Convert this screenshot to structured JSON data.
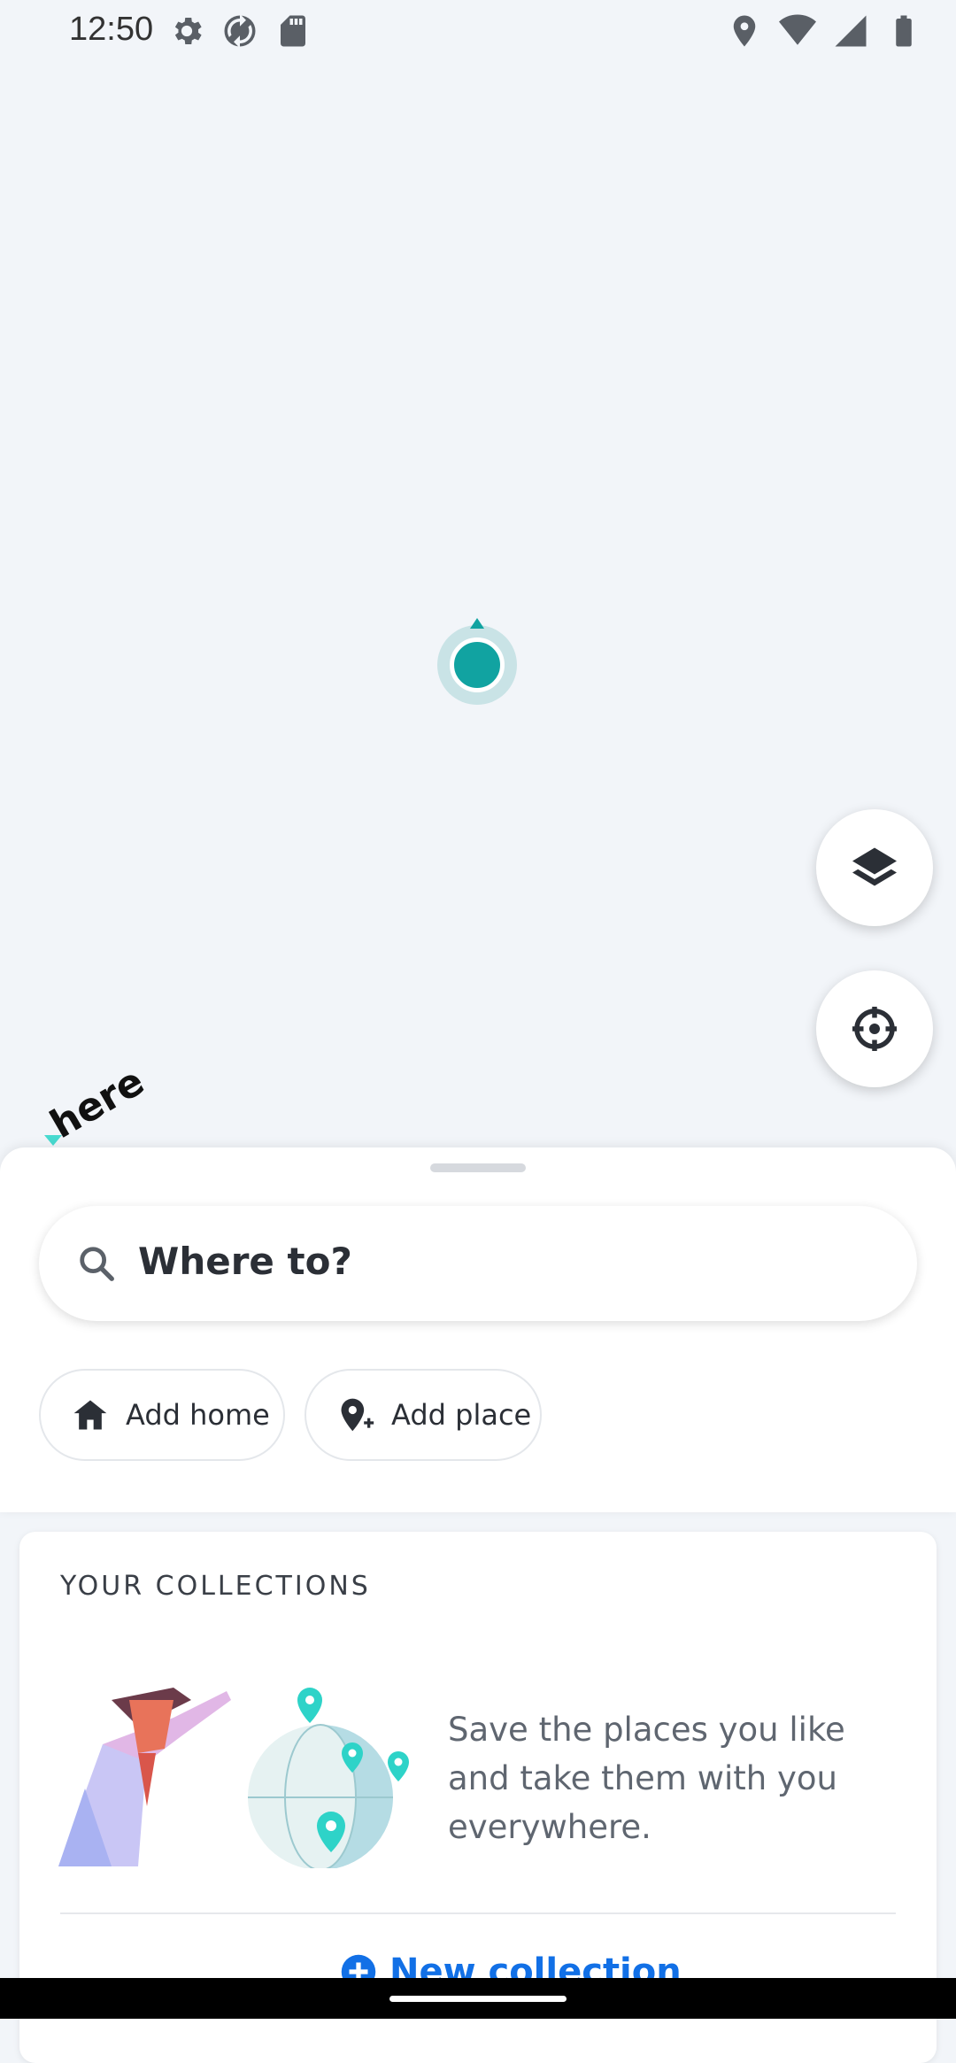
{
  "status_bar": {
    "time": "12:50",
    "left_icons": [
      "settings-icon",
      "sync-icon",
      "sd-card-icon"
    ],
    "right_icons": [
      "location-icon",
      "wifi-icon",
      "signal-icon",
      "battery-icon"
    ]
  },
  "map": {
    "logo": "here",
    "buttons": [
      "layers-icon",
      "recenter-icon"
    ],
    "accent": "#11A3A1"
  },
  "sheet": {
    "search_placeholder": "Where to?",
    "chips": [
      {
        "label": "Add home",
        "icon": "home-icon"
      },
      {
        "label": "Add place",
        "icon": "add-place-icon"
      }
    ]
  },
  "collections": {
    "title": "YOUR COLLECTIONS",
    "description": "Save the places you like and take them with you everywhere.",
    "new_button": "New collection",
    "link_color": "#1270E6"
  }
}
